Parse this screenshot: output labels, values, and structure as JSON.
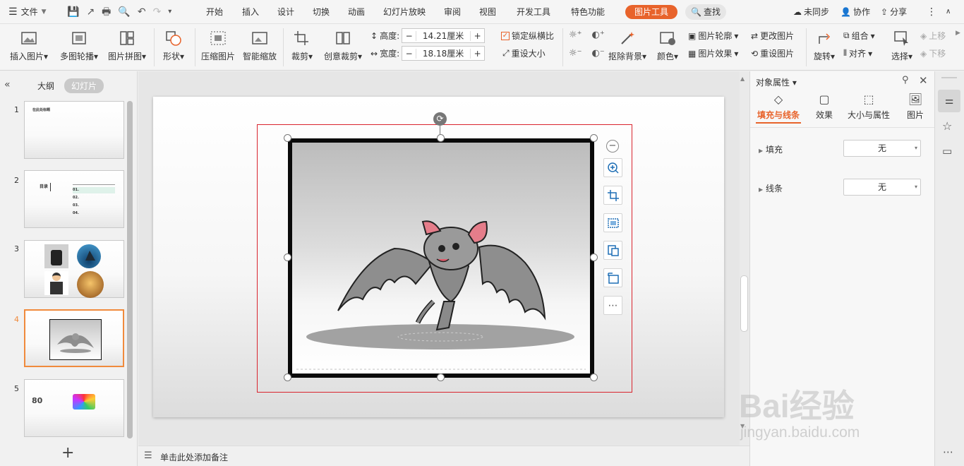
{
  "menubar": {
    "file": "文件",
    "tabs": [
      "开始",
      "插入",
      "设计",
      "切换",
      "动画",
      "幻灯片放映",
      "审阅",
      "视图",
      "开发工具",
      "特色功能"
    ],
    "picture_tools": "图片工具",
    "search": "查找",
    "sync": "未同步",
    "collab": "协作",
    "share": "分享"
  },
  "ribbon": {
    "insert_picture": "插入图片",
    "multi_outline": "多图轮播",
    "picture_collage": "图片拼图",
    "shape": "形状",
    "compress": "压缩图片",
    "smart_scale": "智能缩放",
    "crop": "裁剪",
    "creative_crop": "创意裁剪",
    "height_label": "高度:",
    "height_value": "14.21厘米",
    "width_label": "宽度:",
    "width_value": "18.18厘米",
    "lock_ratio": "锁定纵横比",
    "reset_size": "重设大小",
    "remove_bg": "抠除背景",
    "color": "颜色",
    "picture_outline": "图片轮廓",
    "picture_effect": "图片效果",
    "change_picture": "更改图片",
    "reset_picture": "重设图片",
    "rotate": "旋转",
    "group": "组合",
    "align": "对齐",
    "select": "选择",
    "move_up": "上移",
    "move_down": "下移"
  },
  "left_panel": {
    "outline_tab": "大纲",
    "slides_tab": "幻灯片",
    "slides": [
      {
        "num": "1",
        "text": "在此处标题"
      },
      {
        "num": "2",
        "text": "目录",
        "items": [
          "01.",
          "02.",
          "03.",
          "04."
        ]
      },
      {
        "num": "3"
      },
      {
        "num": "4",
        "active": true
      },
      {
        "num": "5",
        "text": "80"
      }
    ],
    "add_slide": "+"
  },
  "notes": {
    "placeholder": "单击此处添加备注"
  },
  "right_panel": {
    "title": "对象属性",
    "tabs": [
      "填充与线条",
      "效果",
      "大小与属性",
      "图片"
    ],
    "fill_label": "填充",
    "fill_value": "无",
    "line_label": "线条",
    "line_value": "无"
  },
  "watermark": {
    "brand": "Bai经验",
    "url": "jingyan.baidu.com"
  },
  "colors": {
    "accent": "#e8632b",
    "selection_red": "#d9242e",
    "active_thumb": "#f08a3c"
  }
}
